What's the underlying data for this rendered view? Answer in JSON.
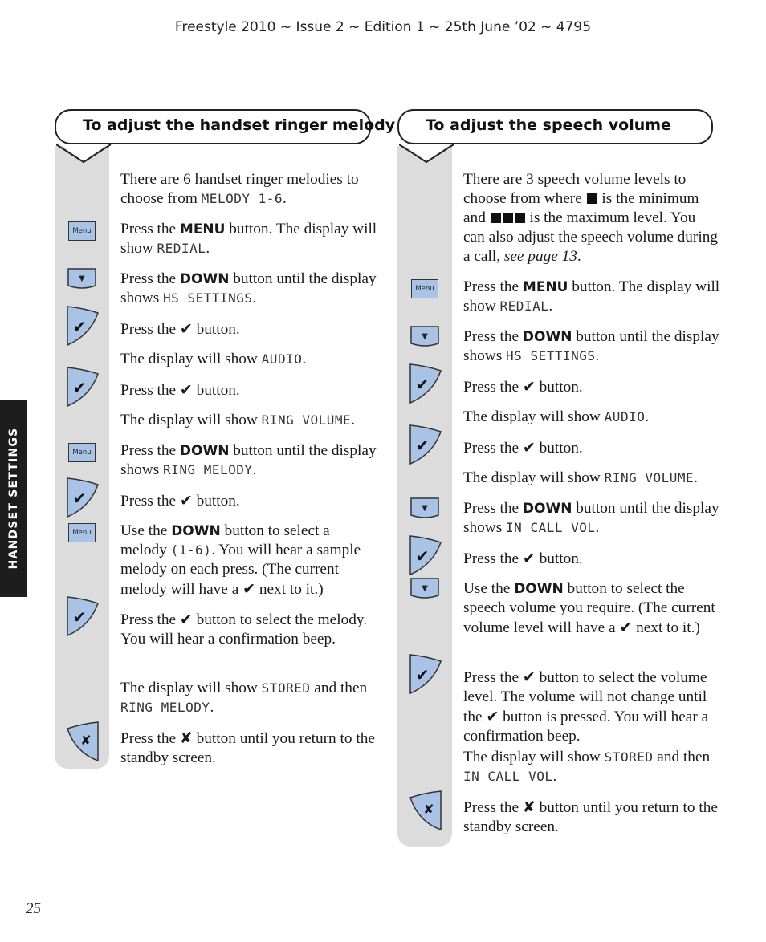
{
  "header": {
    "text": "Freestyle 2010 ~ Issue 2 ~ Edition 1 ~ 25th June ’02 ~ 4795"
  },
  "side_tab": {
    "label": "HANDSET SETTINGS"
  },
  "page_number": "25",
  "icons": {
    "menu_label": "Menu",
    "check": "✔",
    "cross": "✘",
    "down": "▼"
  },
  "left": {
    "title": "To adjust the handset ringer melody",
    "steps": [
      {
        "icon": null,
        "parts": [
          "There are 6 handset ringer melodies to choose from ",
          {
            "lcd": "MELODY 1-6"
          },
          "."
        ]
      },
      {
        "icon": "menu",
        "parts": [
          "Press the ",
          {
            "b": "MENU"
          },
          " button. The display will show ",
          {
            "lcd": "REDIAL"
          },
          "."
        ]
      },
      {
        "icon": "down",
        "parts": [
          "Press the ",
          {
            "b": "DOWN"
          },
          " button until the display shows ",
          {
            "lcd": "HS SETTINGS"
          },
          "."
        ]
      },
      {
        "icon": "check",
        "parts": [
          "Press the ",
          {
            "chk": true
          },
          " button."
        ]
      },
      {
        "icon": null,
        "parts": [
          "The display will show ",
          {
            "lcd": "AUDIO"
          },
          "."
        ]
      },
      {
        "icon": "check",
        "parts": [
          "Press the ",
          {
            "chk": true
          },
          " button."
        ]
      },
      {
        "icon": null,
        "parts": [
          "The display will show ",
          {
            "lcd": "RING VOLUME"
          },
          "."
        ]
      },
      {
        "icon": "menu",
        "parts": [
          "Press the ",
          {
            "b": "DOWN"
          },
          " button until the display shows ",
          {
            "lcd": "RING MELODY"
          },
          "."
        ]
      },
      {
        "icon": "check",
        "parts": [
          "Press the ",
          {
            "chk": true
          },
          " button."
        ]
      },
      {
        "icon": "menu",
        "parts": [
          "Use the ",
          {
            "b": "DOWN"
          },
          " button to select a melody ",
          {
            "lcd": "(1-6)"
          },
          ". You will hear a sample melody on each press. (The current melody will have a ",
          {
            "chk": true
          },
          " next to it.)"
        ]
      },
      {
        "icon": "check",
        "parts": [
          "Press the ",
          {
            "chk": true
          },
          " button to select the melody. You will hear a confirmation beep."
        ]
      },
      {
        "icon": null,
        "parts": [
          "The display will show ",
          {
            "lcd": "STORED"
          },
          " and then ",
          {
            "lcd": "RING MELODY"
          },
          "."
        ]
      },
      {
        "icon": "cross",
        "parts": [
          "Press the ",
          {
            "x": true
          },
          " button until you return to the standby screen."
        ]
      }
    ]
  },
  "right": {
    "title": "To adjust the speech volume",
    "steps": [
      {
        "icon": null,
        "parts": [
          "There are 3 speech volume levels to choose from where ",
          {
            "sq": 1
          },
          " is the minimum and ",
          {
            "sq": 3
          },
          " is the maximum level. You can also adjust the speech volume during a call, ",
          {
            "i": "see page 13"
          },
          "."
        ]
      },
      {
        "icon": "menu",
        "parts": [
          "Press the ",
          {
            "b": "MENU"
          },
          " button. The display will show ",
          {
            "lcd": "REDIAL"
          },
          "."
        ]
      },
      {
        "icon": "down",
        "parts": [
          "Press the ",
          {
            "b": "DOWN"
          },
          " button until the display shows ",
          {
            "lcd": "HS SETTINGS"
          },
          "."
        ]
      },
      {
        "icon": "check",
        "parts": [
          "Press the ",
          {
            "chk": true
          },
          " button."
        ]
      },
      {
        "icon": null,
        "parts": [
          "The display will show ",
          {
            "lcd": "AUDIO"
          },
          "."
        ]
      },
      {
        "icon": "check",
        "parts": [
          "Press the ",
          {
            "chk": true
          },
          " button."
        ]
      },
      {
        "icon": null,
        "parts": [
          "The display will show ",
          {
            "lcd": "RING VOLUME"
          },
          "."
        ]
      },
      {
        "icon": "down",
        "parts": [
          "Press the ",
          {
            "b": "DOWN"
          },
          " button until the display shows ",
          {
            "lcd": "IN CALL VOL"
          },
          "."
        ]
      },
      {
        "icon": "check",
        "parts": [
          "Press the ",
          {
            "chk": true
          },
          " button."
        ]
      },
      {
        "icon": "down",
        "parts": [
          "Use the ",
          {
            "b": "DOWN"
          },
          " button to select the speech volume you require. (The current volume level will have a ",
          {
            "chk": true
          },
          " next to it.)"
        ]
      },
      {
        "icon": "check",
        "parts": [
          "Press the ",
          {
            "chk": true
          },
          " button to select the volume level. The volume will not change until the ",
          {
            "chk": true
          },
          " button is pressed. You will hear a confirmation beep."
        ]
      },
      {
        "icon": null,
        "parts": [
          "The display will show ",
          {
            "lcd": "STORED"
          },
          " and then ",
          {
            "lcd": "IN CALL VOL"
          },
          "."
        ]
      },
      {
        "icon": "cross",
        "parts": [
          "Press the ",
          {
            "x": true
          },
          " button until you return to the standby screen."
        ]
      }
    ]
  }
}
